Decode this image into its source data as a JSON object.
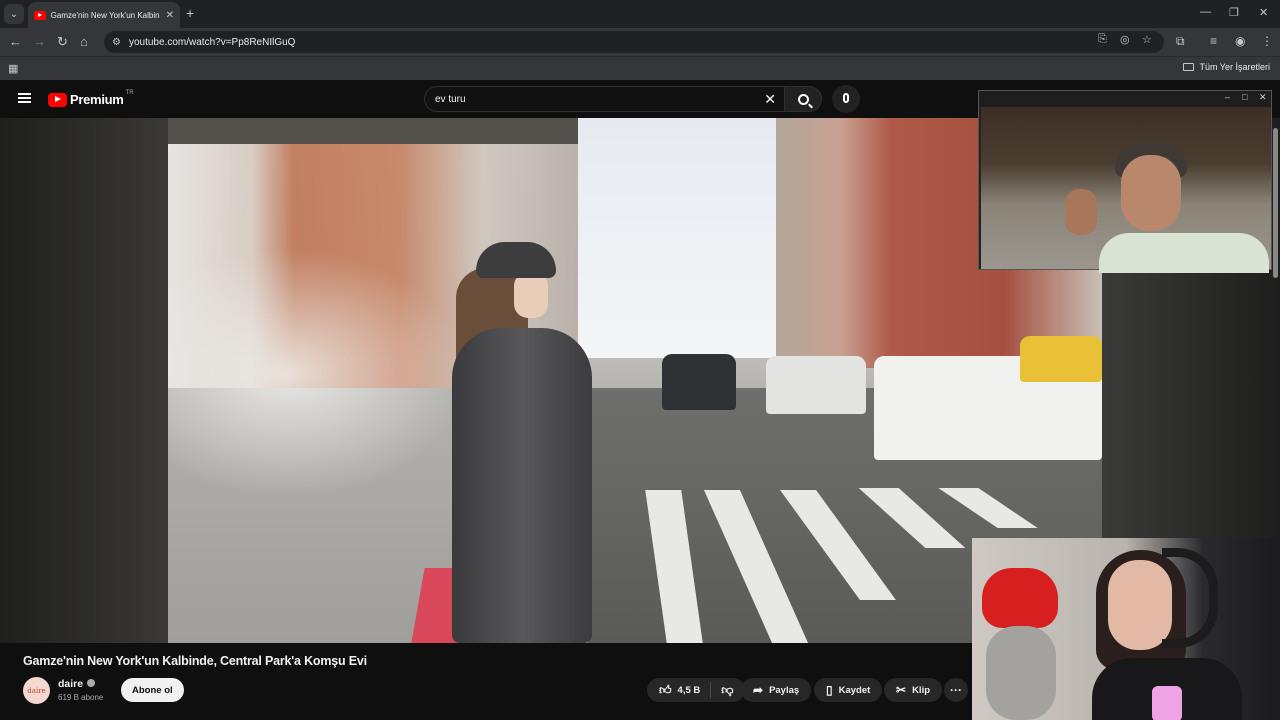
{
  "browser": {
    "tab_title": "Gamze'nin New York'un Kalbinde, Central Park'a Komşu Evi",
    "url": "youtube.com/watch?v=Pp8ReNIlGuQ",
    "bookmarks_all": "Tüm Yer İşaretleri",
    "icons": [
      "tab-search-icon",
      "youtube-favicon-icon",
      "close-icon",
      "plus-icon",
      "minimize-icon",
      "restore-icon",
      "window-close-icon",
      "back-icon",
      "forward-icon",
      "reload-icon",
      "home-icon",
      "site-info-icon",
      "install-icon",
      "tracking-icon",
      "star-icon",
      "extensions-icon",
      "reading-list-icon",
      "profile-icon",
      "kebab-icon",
      "apps-grid-icon",
      "folder-icon"
    ]
  },
  "youtube": {
    "logo_text": "Premium",
    "country": "TR",
    "search": {
      "value": "ev turu"
    },
    "video": {
      "title": "Gamze'nin New York'un Kalbinde, Central Park'a Komşu Evi",
      "channel": "daire",
      "channel_avatar_text": "daire",
      "subscribers": "619 B abone",
      "subscribe_label": "Abone ol",
      "likes": "4,5 B",
      "share_label": "Paylaş",
      "save_label": "Kaydet",
      "clip_label": "Klip"
    }
  },
  "colors": {
    "accent": "#ff0000",
    "background": "#0f0f0f",
    "pill": "#272727"
  }
}
